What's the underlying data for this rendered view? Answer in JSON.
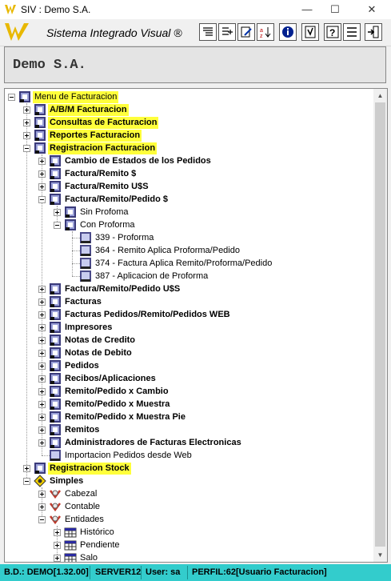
{
  "window": {
    "title": "SIV : Demo S.A.",
    "controls": [
      "—",
      "☐",
      "✕"
    ]
  },
  "toolbar": {
    "app_name": "Sistema Integrado Visual ®",
    "buttons": [
      "list-icon",
      "add-icon",
      "edit-icon",
      "sort-icon",
      "info-icon",
      "help-book-icon",
      "help-icon",
      "minimize-icon",
      "exit-icon"
    ]
  },
  "company": {
    "name": "Demo S.A."
  },
  "tree": {
    "nodes": [
      {
        "label": "Menu de Facturacion",
        "level": 0,
        "bold": false,
        "highlight": true,
        "icon": "menu-folder-icon",
        "toggle": "minus"
      },
      {
        "label": "A/B/M Facturacion",
        "level": 1,
        "bold": true,
        "highlight": true,
        "icon": "menu-folder-icon",
        "toggle": "plus"
      },
      {
        "label": "Consultas de Facturacion",
        "level": 1,
        "bold": true,
        "highlight": true,
        "icon": "menu-folder-icon",
        "toggle": "plus"
      },
      {
        "label": "Reportes Facturacion",
        "level": 1,
        "bold": true,
        "highlight": true,
        "icon": "menu-folder-icon",
        "toggle": "plus"
      },
      {
        "label": "Registracion Facturacion",
        "level": 1,
        "bold": true,
        "highlight": true,
        "icon": "menu-folder-icon",
        "toggle": "minus"
      },
      {
        "label": "Cambio de Estados de los Pedidos",
        "level": 2,
        "bold": true,
        "highlight": false,
        "icon": "menu-folder-icon",
        "toggle": "plus"
      },
      {
        "label": "Factura/Remito $",
        "level": 2,
        "bold": true,
        "highlight": false,
        "icon": "menu-folder-icon",
        "toggle": "plus"
      },
      {
        "label": "Factura/Remito U$S",
        "level": 2,
        "bold": true,
        "highlight": false,
        "icon": "menu-folder-icon",
        "toggle": "plus"
      },
      {
        "label": "Factura/Remito/Pedido $",
        "level": 2,
        "bold": true,
        "highlight": false,
        "icon": "menu-folder-icon",
        "toggle": "minus"
      },
      {
        "label": "Sin Profoma",
        "level": 3,
        "bold": false,
        "highlight": false,
        "icon": "menu-folder-icon",
        "toggle": "plus"
      },
      {
        "label": "Con Proforma",
        "level": 3,
        "bold": false,
        "highlight": false,
        "icon": "menu-folder-icon",
        "toggle": "minus"
      },
      {
        "label": "339 - Proforma",
        "level": 4,
        "bold": false,
        "highlight": false,
        "icon": "program-icon",
        "toggle": "none"
      },
      {
        "label": "364 - Remito Aplica Proforma/Pedido",
        "level": 4,
        "bold": false,
        "highlight": false,
        "icon": "program-icon",
        "toggle": "none"
      },
      {
        "label": "374 - Factura Aplica Remito/Proforma/Pedido",
        "level": 4,
        "bold": false,
        "highlight": false,
        "icon": "program-icon",
        "toggle": "none"
      },
      {
        "label": "387 - Aplicacion de Proforma",
        "level": 4,
        "bold": false,
        "highlight": false,
        "icon": "program-icon",
        "toggle": "none"
      },
      {
        "label": "Factura/Remito/Pedido U$S",
        "level": 2,
        "bold": true,
        "highlight": false,
        "icon": "menu-folder-icon",
        "toggle": "plus"
      },
      {
        "label": "Facturas",
        "level": 2,
        "bold": true,
        "highlight": false,
        "icon": "menu-folder-icon",
        "toggle": "plus"
      },
      {
        "label": "Facturas Pedidos/Remito/Pedidos WEB",
        "level": 2,
        "bold": true,
        "highlight": false,
        "icon": "menu-folder-icon",
        "toggle": "plus"
      },
      {
        "label": "Impresores",
        "level": 2,
        "bold": true,
        "highlight": false,
        "icon": "menu-folder-icon",
        "toggle": "plus"
      },
      {
        "label": "Notas de Credito",
        "level": 2,
        "bold": true,
        "highlight": false,
        "icon": "menu-folder-icon",
        "toggle": "plus"
      },
      {
        "label": "Notas de Debito",
        "level": 2,
        "bold": true,
        "highlight": false,
        "icon": "menu-folder-icon",
        "toggle": "plus"
      },
      {
        "label": "Pedidos",
        "level": 2,
        "bold": true,
        "highlight": false,
        "icon": "menu-folder-icon",
        "toggle": "plus"
      },
      {
        "label": "Recibos/Aplicaciones",
        "level": 2,
        "bold": true,
        "highlight": false,
        "icon": "menu-folder-icon",
        "toggle": "plus"
      },
      {
        "label": "Remito/Pedido x Cambio",
        "level": 2,
        "bold": true,
        "highlight": false,
        "icon": "menu-folder-icon",
        "toggle": "plus"
      },
      {
        "label": "Remito/Pedido x Muestra",
        "level": 2,
        "bold": true,
        "highlight": false,
        "icon": "menu-folder-icon",
        "toggle": "plus"
      },
      {
        "label": "Remito/Pedido x Muestra Pie",
        "level": 2,
        "bold": true,
        "highlight": false,
        "icon": "menu-folder-icon",
        "toggle": "plus"
      },
      {
        "label": "Remitos",
        "level": 2,
        "bold": true,
        "highlight": false,
        "icon": "menu-folder-icon",
        "toggle": "plus"
      },
      {
        "label": "Administradores de Facturas Electronicas",
        "level": 2,
        "bold": true,
        "highlight": false,
        "icon": "menu-folder-icon",
        "toggle": "plus"
      },
      {
        "label": "Importacion Pedidos desde Web",
        "level": 2,
        "bold": false,
        "highlight": false,
        "icon": "program-icon",
        "toggle": "none"
      },
      {
        "label": "Registracion Stock",
        "level": 1,
        "bold": true,
        "highlight": true,
        "icon": "menu-folder-icon",
        "toggle": "plus"
      },
      {
        "label": "Simples",
        "level": 1,
        "bold": true,
        "highlight": false,
        "icon": "simples-diamond-icon",
        "toggle": "minus"
      },
      {
        "label": "Cabezal",
        "level": 2,
        "bold": false,
        "highlight": false,
        "icon": "table-icon",
        "toggle": "plus"
      },
      {
        "label": "Contable",
        "level": 2,
        "bold": false,
        "highlight": false,
        "icon": "table-icon",
        "toggle": "plus"
      },
      {
        "label": "Entidades",
        "level": 2,
        "bold": false,
        "highlight": false,
        "icon": "table-icon",
        "toggle": "minus"
      },
      {
        "label": "Histórico",
        "level": 3,
        "bold": false,
        "highlight": false,
        "icon": "entity-grid-icon",
        "toggle": "plus"
      },
      {
        "label": "Pendiente",
        "level": 3,
        "bold": false,
        "highlight": false,
        "icon": "entity-grid-icon",
        "toggle": "plus"
      },
      {
        "label": "Salo",
        "level": 3,
        "bold": false,
        "highlight": false,
        "icon": "entity-grid-icon",
        "toggle": "plus"
      }
    ]
  },
  "status": {
    "db": "B.D.: DEMO[1.32.00]",
    "server": "SERVER12",
    "user": "User: sa",
    "profile": "PERFIL:62[Usuario Facturacion]"
  },
  "colors": {
    "highlight": "#ffff3b",
    "statusbar": "#33cccc",
    "brand": "#e8b800"
  }
}
